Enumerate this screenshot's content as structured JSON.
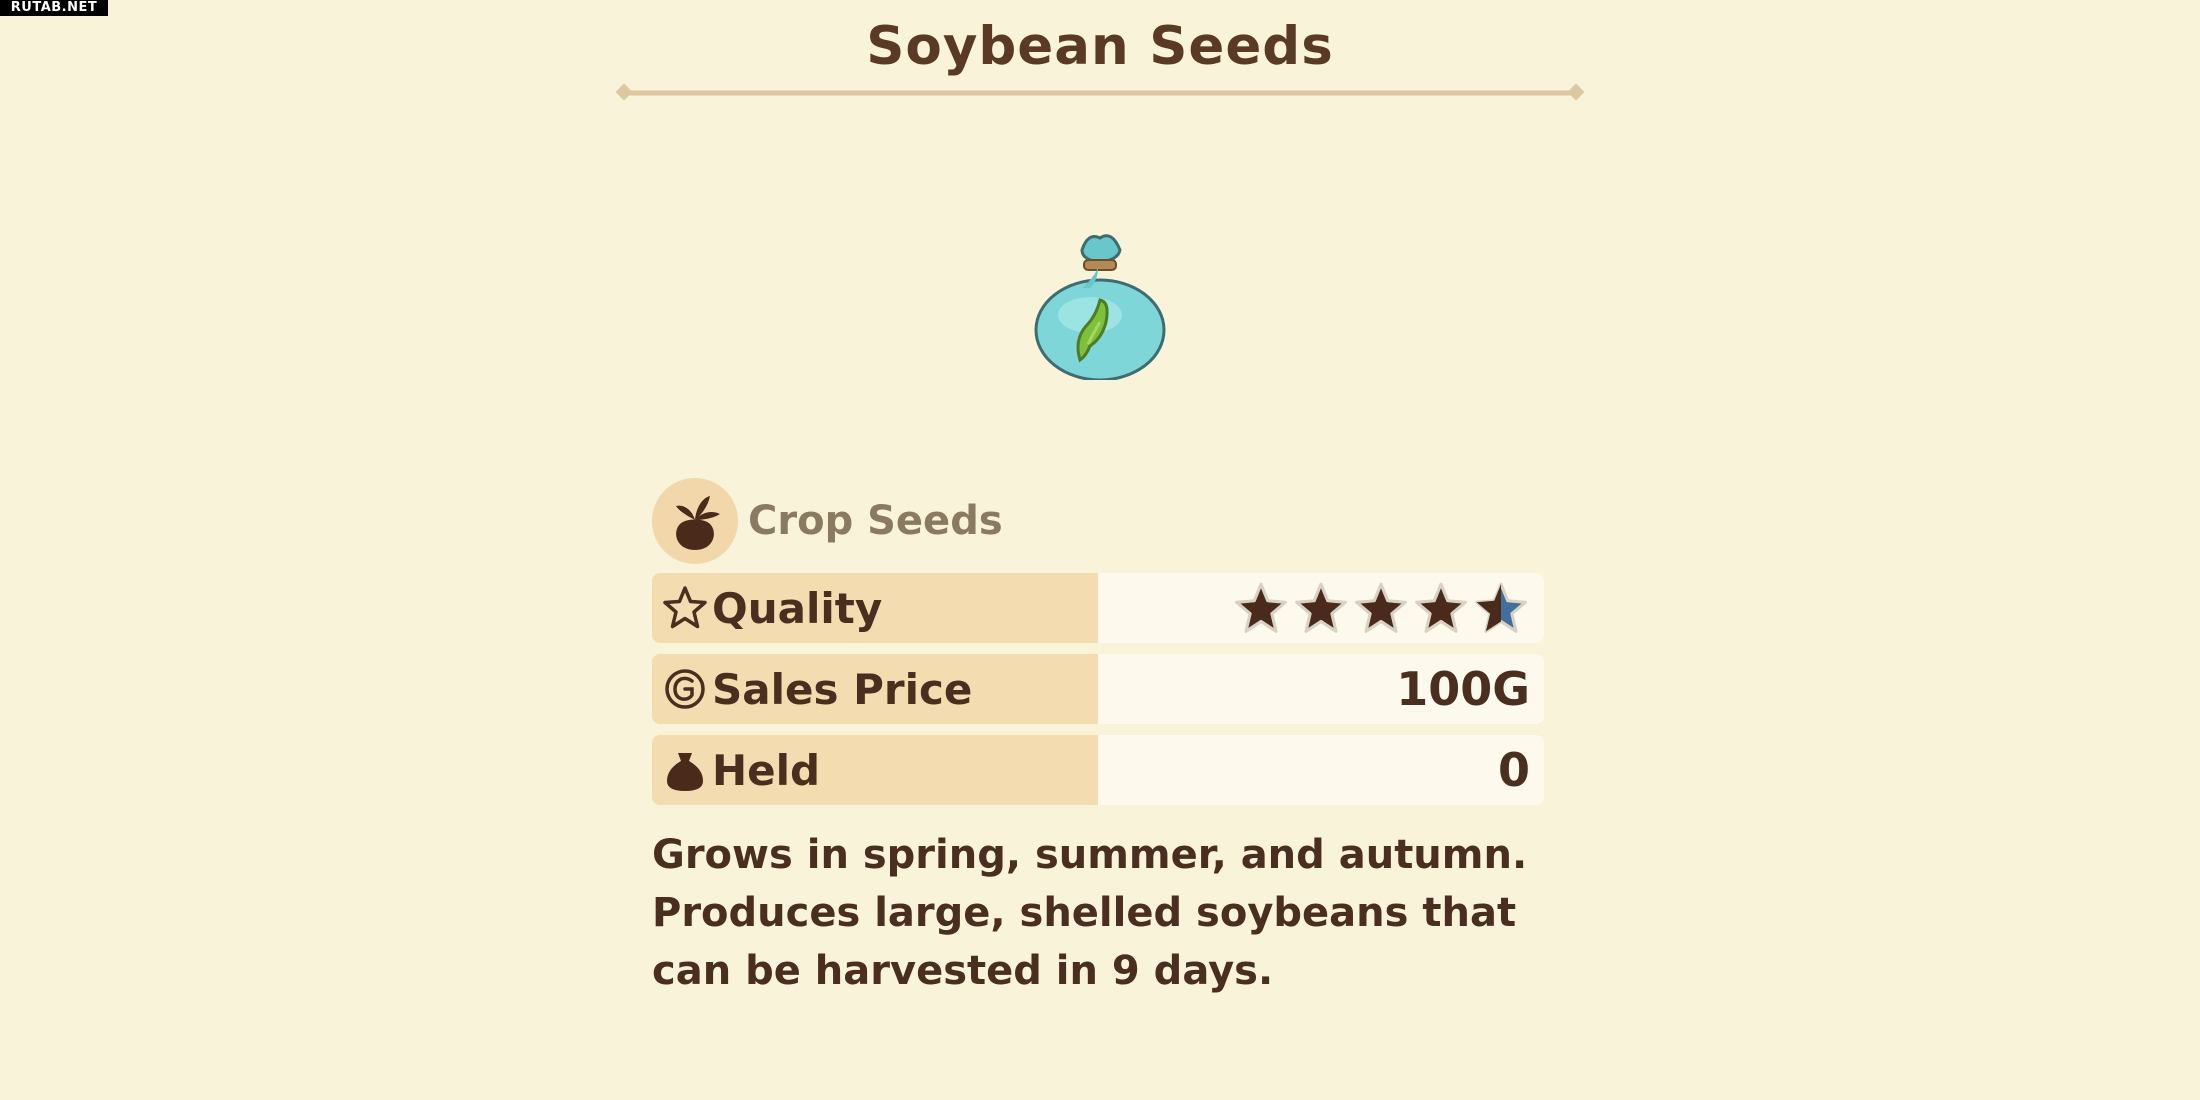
{
  "watermark": "RUTAB.NET",
  "item": {
    "name": "Soybean Seeds",
    "icon": "seed-bag-icon",
    "category": "Crop Seeds",
    "category_icon": "turnip-icon"
  },
  "stats": {
    "quality": {
      "label": "Quality",
      "icon": "star-outline-icon",
      "rating": 4.5,
      "max_rating": 5
    },
    "sales_price": {
      "label": "Sales Price",
      "icon": "gold-coin-icon",
      "value": "100G"
    },
    "held": {
      "label": "Held",
      "icon": "pouch-icon",
      "value": "0"
    }
  },
  "description": "Grows in spring, summer, and autumn. Produces large, shelled soybeans that can be harvested in 9 days.",
  "colors": {
    "background": "#f8f3d9",
    "label_cell": "#f2dcb0",
    "value_cell": "#fdf9ec",
    "text_dark": "#4a2e1f",
    "category_text": "#8a7a62",
    "star_filled": "#4a2a1a",
    "star_half": "#3f6f9a",
    "bag": "#7fd6d8"
  }
}
